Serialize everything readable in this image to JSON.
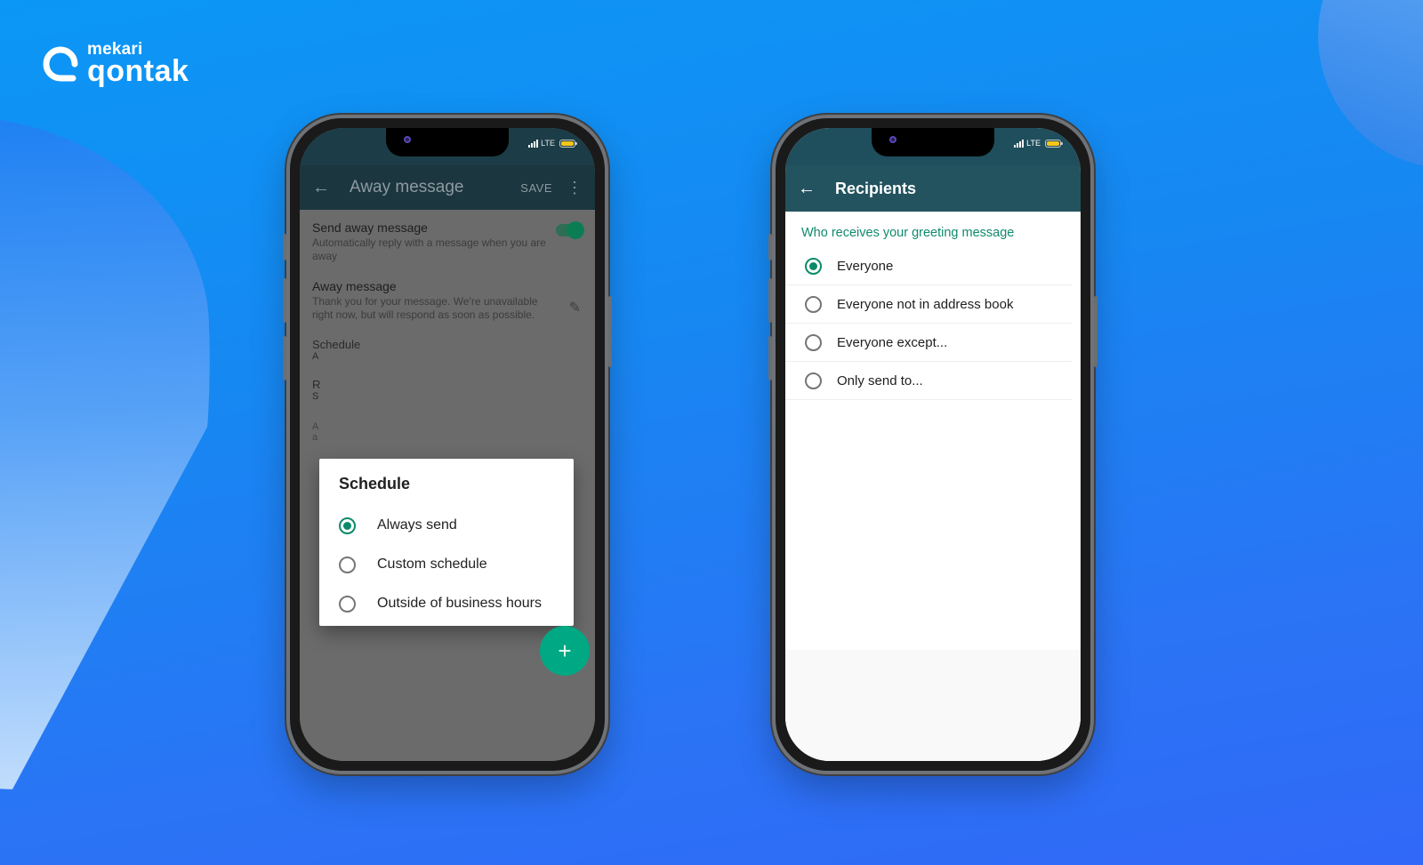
{
  "brand": {
    "sub_name": "mekari",
    "name": "qontak"
  },
  "colors": {
    "accent_green": "#0b8a69",
    "fab_green": "#00a884",
    "header_teal": "#23535f",
    "background_blue": "#1787f2"
  },
  "status_bar": {
    "network": "LTE",
    "signal_icon": "signal-bars-icon",
    "battery_icon": "battery-icon"
  },
  "left_phone": {
    "appbar": {
      "back_icon": "arrow-left-icon",
      "title": "Away message",
      "save_label": "SAVE",
      "more_icon": "more-vertical-icon"
    },
    "settings": [
      {
        "title": "Send away message",
        "subtitle": "Automatically reply with a message when you are away",
        "toggle_on": true
      },
      {
        "title": "Away message",
        "subtitle": "Thank you for your message. We're unavailable right now, but will respond as soon as possible.",
        "edit_icon": "pencil-icon"
      }
    ],
    "partial_items": [
      "Schedule",
      "A",
      "R",
      "S",
      "A",
      "a"
    ],
    "dialog": {
      "title": "Schedule",
      "options": [
        {
          "label": "Always send",
          "selected": true
        },
        {
          "label": "Custom schedule",
          "selected": false
        },
        {
          "label": "Outside of business hours",
          "selected": false
        }
      ]
    },
    "fab_icon": "plus-icon",
    "fab_label": "+"
  },
  "right_phone": {
    "appbar": {
      "back_icon": "arrow-left-icon",
      "title": "Recipients"
    },
    "section_label": "Who receives your greeting message",
    "options": [
      {
        "label": "Everyone",
        "selected": true
      },
      {
        "label": "Everyone not in address book",
        "selected": false
      },
      {
        "label": "Everyone except...",
        "selected": false
      },
      {
        "label": "Only send to...",
        "selected": false
      }
    ]
  }
}
